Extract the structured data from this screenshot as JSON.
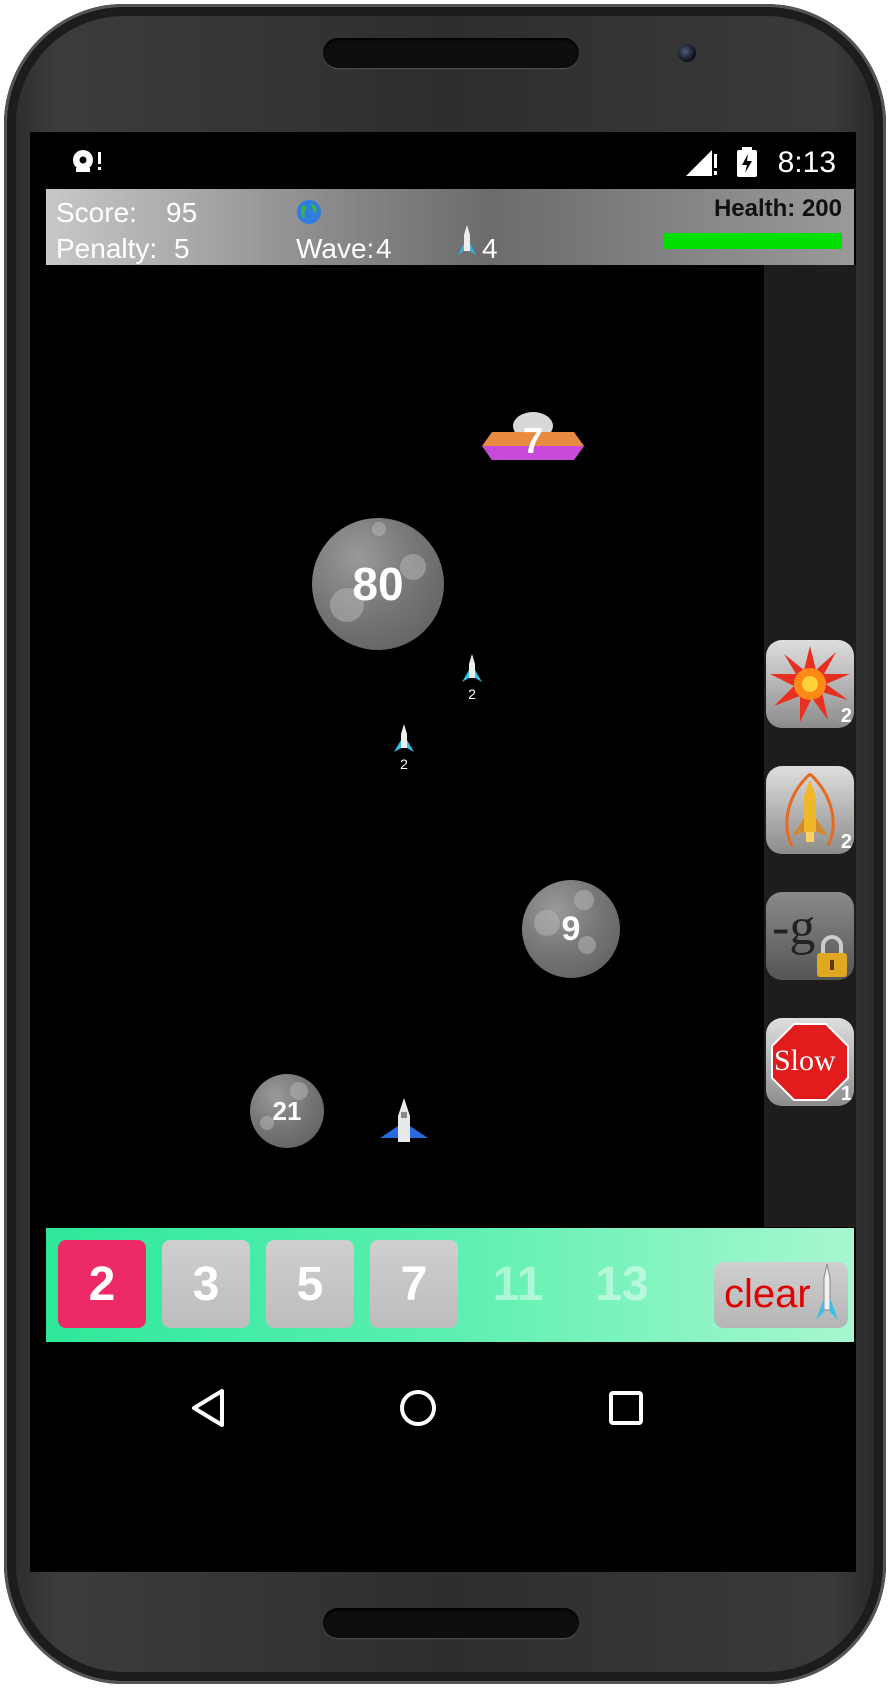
{
  "status": {
    "time": "8:13"
  },
  "hud": {
    "score_label": "Score:",
    "score_value": "95",
    "penalty_label": "Penalty:",
    "penalty_value": "5",
    "wave_label": "Wave:",
    "wave_value": "4",
    "rockets_value": "4",
    "health_label": "Health: 200",
    "health_fraction": 1.0
  },
  "field": {
    "ufo_value": "7",
    "asteroids": [
      "80",
      "9",
      "21"
    ],
    "missile_labels": [
      "2",
      "2"
    ]
  },
  "powerups": [
    {
      "name": "explosion",
      "count": "2"
    },
    {
      "name": "rocket-boost",
      "count": "2"
    },
    {
      "name": "gravity",
      "label": "-g",
      "locked": true
    },
    {
      "name": "slow",
      "label": "Slow",
      "count": "1"
    }
  ],
  "keypad": {
    "keys": [
      "2",
      "3",
      "5",
      "7",
      "11",
      "13"
    ],
    "selected": "2",
    "disabled": [
      "11",
      "13"
    ],
    "clear_label": "clear"
  },
  "colors": {
    "health": "#00e000",
    "keypad_bg": "#2ee89a",
    "selected_key": "#ee2a66",
    "clear_text": "#e00000"
  }
}
